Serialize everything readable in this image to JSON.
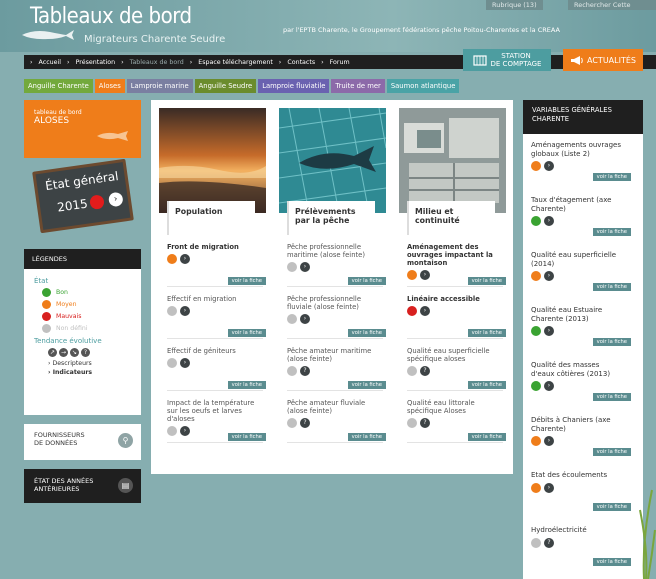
{
  "header": {
    "title": "Tableaux de bord",
    "subtitle": "Migrateurs Charente Seudre",
    "partners": "par l'EPTB Charente, le Groupement fédérations pêche Poitou-Charentes et la CREAA",
    "top_tab_1": "Rubrique (13)",
    "top_tab_2": "Rechercher Cette"
  },
  "nav": {
    "items": [
      "Accueil",
      "Présentation",
      "Tableaux de bord",
      "Espace téléchargement",
      "Contacts",
      "Forum"
    ],
    "separator": "›"
  },
  "station": {
    "label_1": "STATION",
    "label_2": "DE COMPTAGE"
  },
  "actualites": {
    "label": "ACTUALITÉS"
  },
  "species_tabs": [
    {
      "label": "Anguille Charente",
      "color": "#73a93c"
    },
    {
      "label": "Aloses",
      "color": "#ef7d1a"
    },
    {
      "label": "Lamproie marine",
      "color": "#7a7fa1"
    },
    {
      "label": "Anguille Seudre",
      "color": "#6b8c2d"
    },
    {
      "label": "Lamproie fluviatile",
      "color": "#6a62b0"
    },
    {
      "label": "Truite de mer",
      "color": "#8c6aa9"
    },
    {
      "label": "Saumon atlantique",
      "color": "#4aa3a6"
    }
  ],
  "tb_card": {
    "small": "tableau de bord",
    "big": "ALOSES"
  },
  "etat_general": {
    "title": "État général",
    "year": "2015",
    "status_color": "#e21c1c"
  },
  "legend": {
    "heading": "LÉGENDES",
    "etat_label": "État",
    "states": [
      {
        "label": "Bon",
        "color": "#3aa332"
      },
      {
        "label": "Moyen",
        "color": "#ef7d1a"
      },
      {
        "label": "Mauvais",
        "color": "#d8201f"
      },
      {
        "label": "Non défini",
        "color": "#c0c0c0"
      }
    ],
    "tendance_label": "Tendance évolutive",
    "descripteurs": "Descripteurs",
    "indicateurs": "Indicateurs"
  },
  "fournisseurs": {
    "label_1": "FOURNISSEURS",
    "label_2": "DE DONNÉES"
  },
  "annees": {
    "label_1": "ÉTAT DES ANNÉES",
    "label_2": "ANTÉRIEURES"
  },
  "voir_la_fiche": "voir la fiche",
  "columns": [
    {
      "title": "Population",
      "indicators": [
        {
          "name": "Front de migration",
          "bold": true,
          "state": "#ef7d1a",
          "trend": "›"
        },
        {
          "name": "Effectif en migration",
          "bold": false,
          "state": "#c0c0c0",
          "trend": "›"
        },
        {
          "name": "Effectif de géniteurs",
          "bold": false,
          "state": "#c0c0c0",
          "trend": "›"
        },
        {
          "name": "Impact de la température sur les oeufs et larves d'aloses",
          "bold": false,
          "state": "#c0c0c0",
          "trend": "›"
        }
      ]
    },
    {
      "title": "Prélèvements par la pêche",
      "indicators": [
        {
          "name": "Pêche professionnelle maritime (alose feinte)",
          "bold": false,
          "state": "#c0c0c0",
          "trend": "›"
        },
        {
          "name": "Pêche professionnelle fluviale (alose feinte)",
          "bold": false,
          "state": "#c0c0c0",
          "trend": "›"
        },
        {
          "name": "Pêche amateur maritime (alose feinte)",
          "bold": false,
          "state": "#c0c0c0",
          "trend": "?"
        },
        {
          "name": "Pêche amateur fluviale (alose feinte)",
          "bold": false,
          "state": "#c0c0c0",
          "trend": "?"
        }
      ]
    },
    {
      "title": "Milieu et continuité",
      "indicators": [
        {
          "name": "Aménagement des ouvrages impactant la montaison",
          "bold": true,
          "state": "#ef7d1a",
          "trend": "›"
        },
        {
          "name": "Linéaire accessible",
          "bold": true,
          "state": "#d8201f",
          "trend": "›"
        },
        {
          "name": "Qualité eau superficielle spécifique aloses",
          "bold": false,
          "state": "#c0c0c0",
          "trend": "?"
        },
        {
          "name": "Qualité eau littorale spécifique Aloses",
          "bold": false,
          "state": "#c0c0c0",
          "trend": "?"
        }
      ]
    }
  ],
  "variables": {
    "heading_1": "VARIABLES GÉNÉRALES",
    "heading_2": "CHARENTE",
    "items": [
      {
        "name": "Aménagements ouvrages globaux (Liste 2)",
        "state": "#ef7d1a",
        "trend": "›"
      },
      {
        "name": "Taux d'étagement (axe Charente)",
        "state": "#3aa332",
        "trend": "›"
      },
      {
        "name": "Qualité eau superficielle (2014)",
        "state": "#ef7d1a",
        "trend": "›"
      },
      {
        "name": "Qualité eau Estuaire Charente (2013)",
        "state": "#3aa332",
        "trend": "›"
      },
      {
        "name": "Qualité des masses d'eaux côtières (2013)",
        "state": "#3aa332",
        "trend": "›"
      },
      {
        "name": "Débits à Chaniers (axe Charente)",
        "state": "#ef7d1a",
        "trend": "›"
      },
      {
        "name": "Etat des écoulements",
        "state": "#ef7d1a",
        "trend": "›"
      },
      {
        "name": "Hydroélectricité",
        "state": "#c0c0c0",
        "trend": "?"
      }
    ]
  }
}
